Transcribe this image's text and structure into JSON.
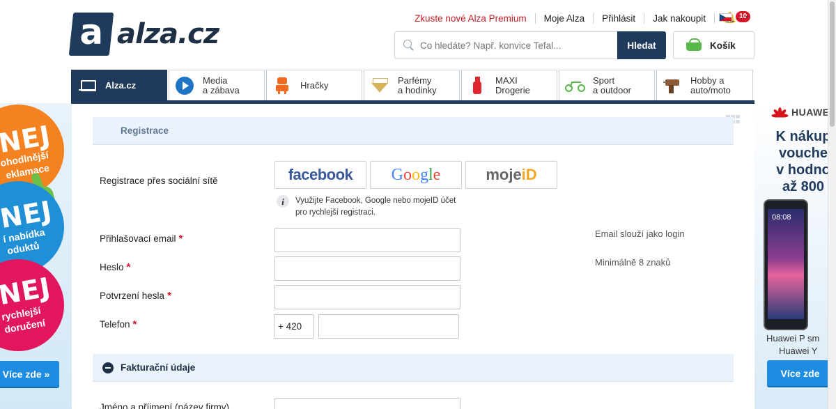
{
  "header": {
    "logo_mark": "a",
    "logo_text": "alza.cz",
    "links": [
      "Zkuste nové Alza Premium",
      "Moje Alza",
      "Přihlásit",
      "Jak nakoupit"
    ],
    "notification_count": "10",
    "language": "CZ",
    "search": {
      "placeholder": "Co hledáte? Např. konvice Tefal...",
      "button": "Hledat"
    },
    "cart_label": "Košík"
  },
  "tabs": [
    {
      "line1": "Alza.cz",
      "line2": "",
      "icon": "laptop-icon"
    },
    {
      "line1": "Media",
      "line2": "a zábava",
      "icon": "play-icon"
    },
    {
      "line1": "Hračky",
      "line2": "",
      "icon": "robot-icon"
    },
    {
      "line1": "Parfémy",
      "line2": "a hodinky",
      "icon": "diamond-icon"
    },
    {
      "line1": "MAXI",
      "line2": "Drogerie",
      "icon": "bottle-icon"
    },
    {
      "line1": "Sport",
      "line2": "a outdoor",
      "icon": "bike-icon"
    },
    {
      "line1": "Hobby a",
      "line2": "auto/moto",
      "icon": "drill-icon"
    }
  ],
  "form": {
    "section_title": "Registrace",
    "social_label": "Registrace přes sociální sítě",
    "social": {
      "facebook": "facebook",
      "google": [
        "G",
        "o",
        "o",
        "g",
        "l",
        "e"
      ],
      "mojeid_a": "moje",
      "mojeid_b": "iD"
    },
    "info_line1": "Využijte Facebook, Google nebo mojeID účet",
    "info_line2": "pro rychlejší registraci.",
    "email_label": "Přihlašovací email",
    "password_label": "Heslo",
    "confirm_label": "Potvrzení hesla",
    "phone_label": "Telefon",
    "phone_prefix": "+ 420",
    "email_hint": "Email slouží jako login",
    "password_hint": "Minimálně 8 znaků",
    "required_mark": "*",
    "billing_title": "Fakturační údaje",
    "name_label": "Jméno a příjmení (název firmy)"
  },
  "left_banner": {
    "nej": "NEJ",
    "orange_text1": "ohodlnější",
    "orange_text2": "eklamace",
    "blue_text1": "í nabídka",
    "blue_text2": "oduktů",
    "pink_text1": "rychlejší",
    "pink_text2": "doručení",
    "button": "Více zde »"
  },
  "right_banner": {
    "brand": "HUAWEI",
    "promo_lines": [
      "K nákup",
      "vouche",
      "v hodno",
      "až 800"
    ],
    "phone_time": "08:08",
    "caption1": "Huawei P sm",
    "caption2": "Huawei Y",
    "button": "Více zde"
  }
}
